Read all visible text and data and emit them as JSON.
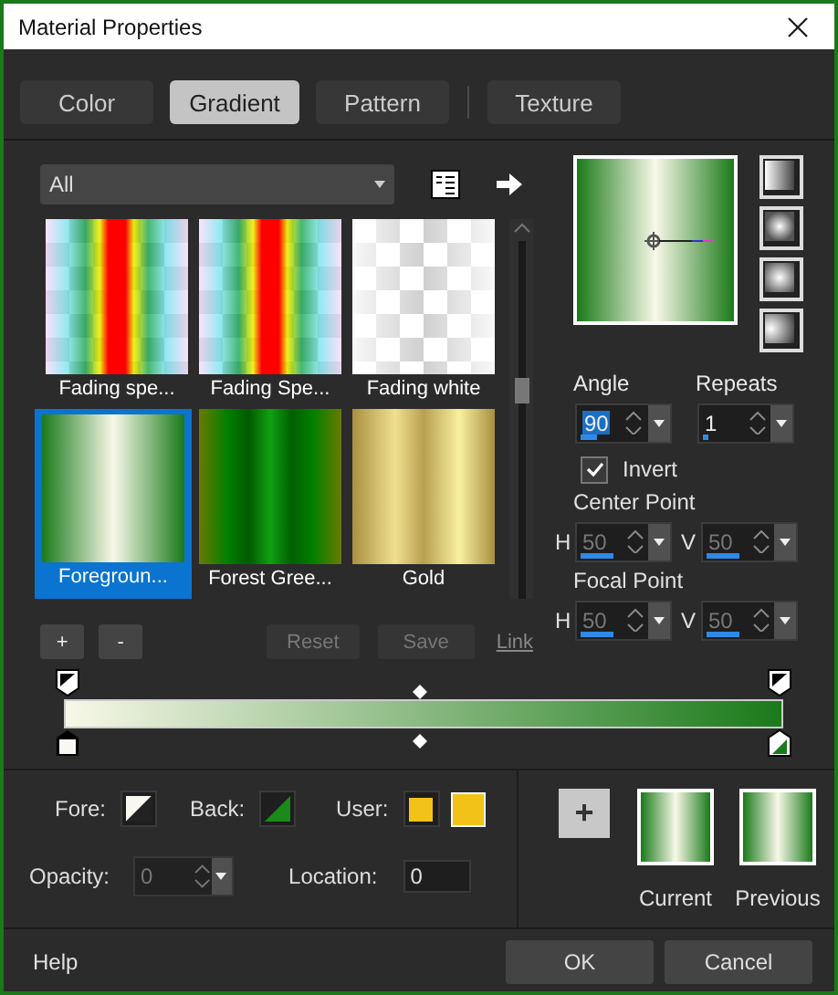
{
  "window": {
    "title": "Material Properties"
  },
  "tabs": [
    {
      "label": "Color",
      "selected": false
    },
    {
      "label": "Gradient",
      "selected": true
    },
    {
      "label": "Pattern",
      "selected": false
    },
    {
      "label": "Texture",
      "selected": false
    }
  ],
  "gallery": {
    "filter": "All",
    "items": [
      {
        "label": "Fading spe...",
        "kind": "spectrum",
        "selected": false
      },
      {
        "label": "Fading Spe...",
        "kind": "spectrum",
        "selected": false
      },
      {
        "label": "Fading white",
        "kind": "fade-white",
        "selected": false
      },
      {
        "label": "Foregroun...",
        "kind": "fg-bg",
        "selected": true
      },
      {
        "label": "Forest Gree...",
        "kind": "forest",
        "selected": false
      },
      {
        "label": "Gold",
        "kind": "gold",
        "selected": false
      }
    ]
  },
  "gallery_buttons": [
    {
      "label": "+",
      "kind": "button",
      "disabled": false
    },
    {
      "label": "-",
      "kind": "button",
      "disabled": false
    },
    {
      "label": "Reset",
      "kind": "button",
      "disabled": true
    },
    {
      "label": "Save",
      "kind": "button",
      "disabled": true
    },
    {
      "label": "Link",
      "kind": "link",
      "disabled": true
    }
  ],
  "styles": [
    {
      "kind": "linear"
    },
    {
      "kind": "rectangular"
    },
    {
      "kind": "sunburst"
    },
    {
      "kind": "radial"
    }
  ],
  "angle": {
    "label": "Angle",
    "value": "90",
    "level": 0.25,
    "highlighted": true
  },
  "repeats": {
    "label": "Repeats",
    "value": "1",
    "level": 0.08,
    "highlighted": false
  },
  "invert": {
    "label": "Invert",
    "checked": true
  },
  "center_point": {
    "label": "Center Point",
    "h": {
      "label": "H",
      "value": "50",
      "level": 0.5
    },
    "v": {
      "label": "V",
      "value": "50",
      "level": 0.5
    }
  },
  "focal_point": {
    "label": "Focal Point",
    "h": {
      "label": "H",
      "value": "50",
      "level": 0.5
    },
    "v": {
      "label": "V",
      "value": "50",
      "level": 0.5
    }
  },
  "fore": {
    "label": "Fore:"
  },
  "back": {
    "label": "Back:"
  },
  "user": {
    "label": "User:"
  },
  "opacity": {
    "label": "Opacity:",
    "value": "0",
    "disabled": true
  },
  "location": {
    "label": "Location:",
    "value": "0"
  },
  "add_button": "+",
  "swatches": [
    {
      "label": "Current"
    },
    {
      "label": "Previous"
    }
  ],
  "footer": {
    "help": "Help",
    "buttons": [
      "OK",
      "Cancel"
    ]
  }
}
